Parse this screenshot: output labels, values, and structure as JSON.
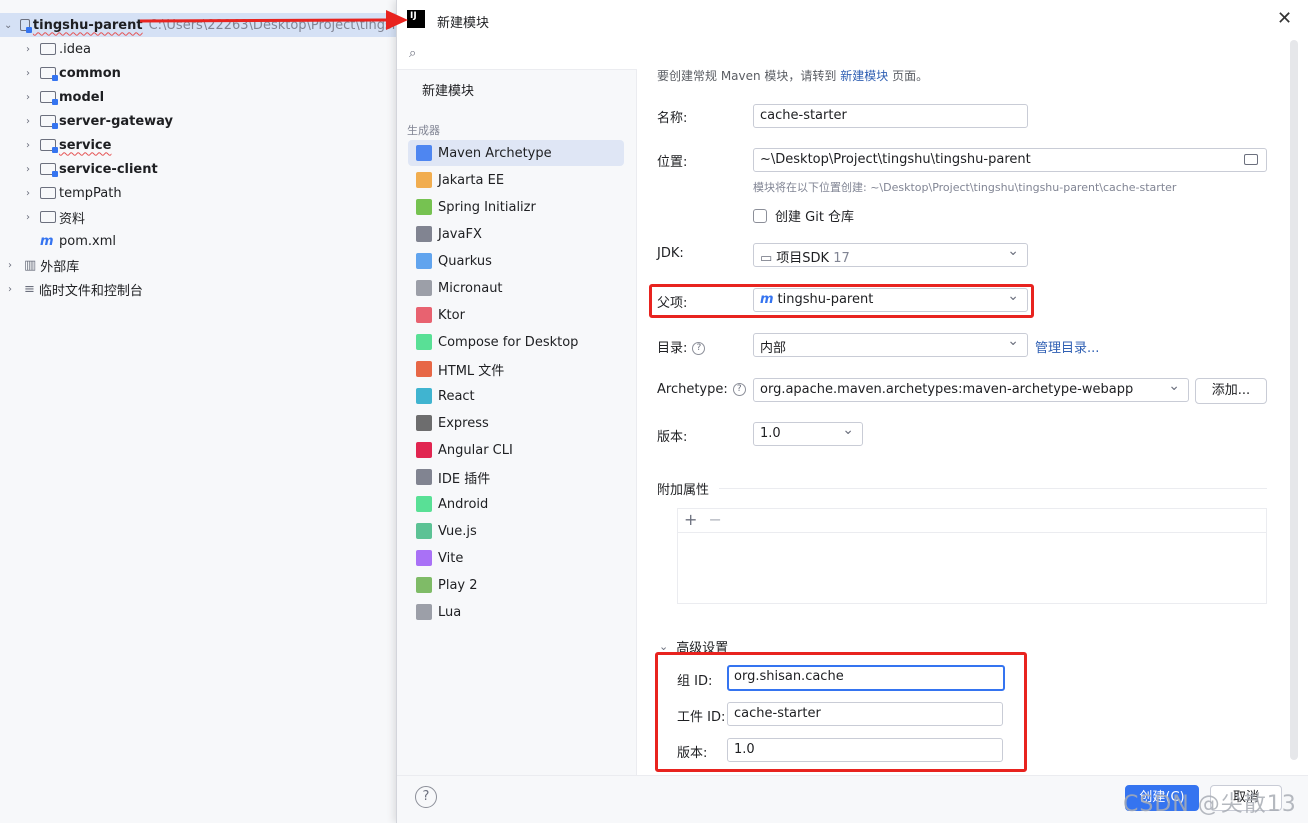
{
  "tree": {
    "root": {
      "name": "tingshu-parent",
      "path": "C:\\Users\\22263\\Desktop\\Project\\tingsh"
    },
    "items": [
      {
        "label": ".idea"
      },
      {
        "label": "common"
      },
      {
        "label": "model"
      },
      {
        "label": "server-gateway"
      },
      {
        "label": "service"
      },
      {
        "label": "service-client"
      },
      {
        "label": "tempPath"
      },
      {
        "label": "资料"
      },
      {
        "label": "pom.xml"
      }
    ],
    "external_libs": "外部库",
    "scratches": "临时文件和控制台"
  },
  "dialog": {
    "title": "新建模块",
    "logo_text": "IJ",
    "search_placeholder": "",
    "new_module": "新建模块",
    "generators_header": "生成器",
    "generators": [
      {
        "label": "Maven Archetype",
        "icon": "maven-icon",
        "color": "#3574f0"
      },
      {
        "label": "Jakarta EE",
        "icon": "jakarta-icon",
        "color": "#f0a030"
      },
      {
        "label": "Spring Initializr",
        "icon": "spring-icon",
        "color": "#5fb832"
      },
      {
        "label": "JavaFX",
        "icon": "javafx-icon",
        "color": "#6c707e"
      },
      {
        "label": "Quarkus",
        "icon": "quarkus-icon",
        "color": "#4695eb"
      },
      {
        "label": "Micronaut",
        "icon": "micronaut-icon",
        "color": "#8c8f99"
      },
      {
        "label": "Ktor",
        "icon": "ktor-icon",
        "color": "#e54857"
      },
      {
        "label": "Compose for Desktop",
        "icon": "compose-icon",
        "color": "#3ddc84"
      },
      {
        "label": "HTML 文件",
        "icon": "html5-icon",
        "color": "#e44d26"
      },
      {
        "label": "React",
        "icon": "react-icon",
        "color": "#20a8c8"
      },
      {
        "label": "Express",
        "icon": "express-icon",
        "color": "#555555"
      },
      {
        "label": "Angular CLI",
        "icon": "angular-icon",
        "color": "#dd0031"
      },
      {
        "label": "IDE 插件",
        "icon": "plugin-icon",
        "color": "#6c707e"
      },
      {
        "label": "Android",
        "icon": "android-icon",
        "color": "#3ddc84"
      },
      {
        "label": "Vue.js",
        "icon": "vue-icon",
        "color": "#41b883"
      },
      {
        "label": "Vite",
        "icon": "vite-icon",
        "color": "#9b59f5"
      },
      {
        "label": "Play 2",
        "icon": "play-icon",
        "color": "#6ab04c"
      },
      {
        "label": "Lua",
        "icon": "lua-icon",
        "color": "#8c8f99"
      }
    ],
    "hint_prefix": "要创建常规 Maven 模块，请转到 ",
    "hint_link": "新建模块",
    "hint_suffix": " 页面。",
    "name_label": "名称:",
    "name_value": "cache-starter",
    "location_label": "位置:",
    "location_value": "~\\Desktop\\Project\\tingshu\\tingshu-parent",
    "location_hint": "模块将在以下位置创建: ~\\Desktop\\Project\\tingshu\\tingshu-parent\\cache-starter",
    "git_label": "创建 Git 仓库",
    "git_checked": false,
    "jdk_label": "JDK:",
    "jdk_value": "项目SDK",
    "jdk_version": "17",
    "parent_label": "父项:",
    "parent_value": "tingshu-parent",
    "catalog_label": "目录:",
    "catalog_value": "内部",
    "catalog_link": "管理目录...",
    "archetype_label": "Archetype:",
    "archetype_value": "org.apache.maven.archetypes:maven-archetype-webapp",
    "add_button": "添加...",
    "version_label": "版本:",
    "version_value": "1.0",
    "extra_props_label": "附加属性",
    "add_icon": "+",
    "remove_icon": "−",
    "advanced_label": "高级设置",
    "group_label": "组 ID:",
    "group_value": "org.shisan.cache",
    "artifact_label": "工件 ID:",
    "artifact_value": "cache-starter",
    "adv_version_label": "版本:",
    "adv_version_value": "1.0",
    "help_icon": "?",
    "create_button": "创建(C)",
    "cancel_button": "取消",
    "watermark": "CSDN @尖散13",
    "accent_color": "#3574f0",
    "highlight_color": "#e8231f"
  }
}
